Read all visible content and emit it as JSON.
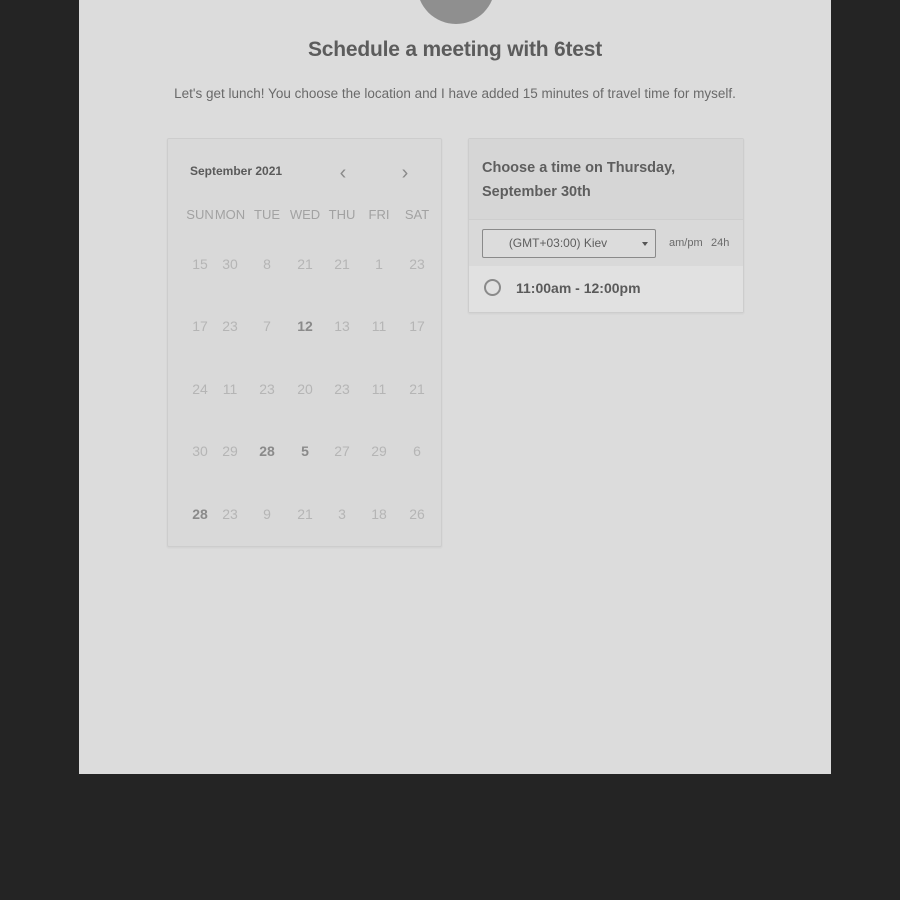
{
  "header": {
    "title": "Schedule a meeting with 6test",
    "description": "Let's get lunch! You choose the location and I have added 15 minutes of travel time for myself."
  },
  "calendar": {
    "month_label": "September 2021",
    "prev_icon": "chevron-left-icon",
    "next_icon": "chevron-right-icon",
    "weekdays": [
      "SUN",
      "MON",
      "TUE",
      "WED",
      "THU",
      "FRI",
      "SAT"
    ],
    "weeks": [
      [
        "15",
        "30",
        "8",
        "21",
        "21",
        "1",
        "23"
      ],
      [
        "17",
        "23",
        "7",
        "12",
        "13",
        "11",
        "17"
      ],
      [
        "24",
        "11",
        "23",
        "20",
        "23",
        "11",
        "21"
      ],
      [
        "30",
        "29",
        "28",
        "5",
        "27",
        "29",
        "6"
      ],
      [
        "28",
        "23",
        "9",
        "21",
        "3",
        "18",
        "26"
      ]
    ],
    "available": [
      [
        1,
        3
      ],
      [
        3,
        2
      ],
      [
        3,
        3
      ],
      [
        4,
        0
      ]
    ]
  },
  "time_panel": {
    "heading": "Choose a time on Thursday, September 30th",
    "timezone": "(GMT+03:00) Kiev",
    "format_ampm": "am/pm",
    "format_24h": "24h",
    "slots": [
      {
        "label": "11:00am - 12:00pm"
      }
    ]
  },
  "colors": {
    "page_bg": "#dcdcdc",
    "outer_bg": "#242424"
  }
}
